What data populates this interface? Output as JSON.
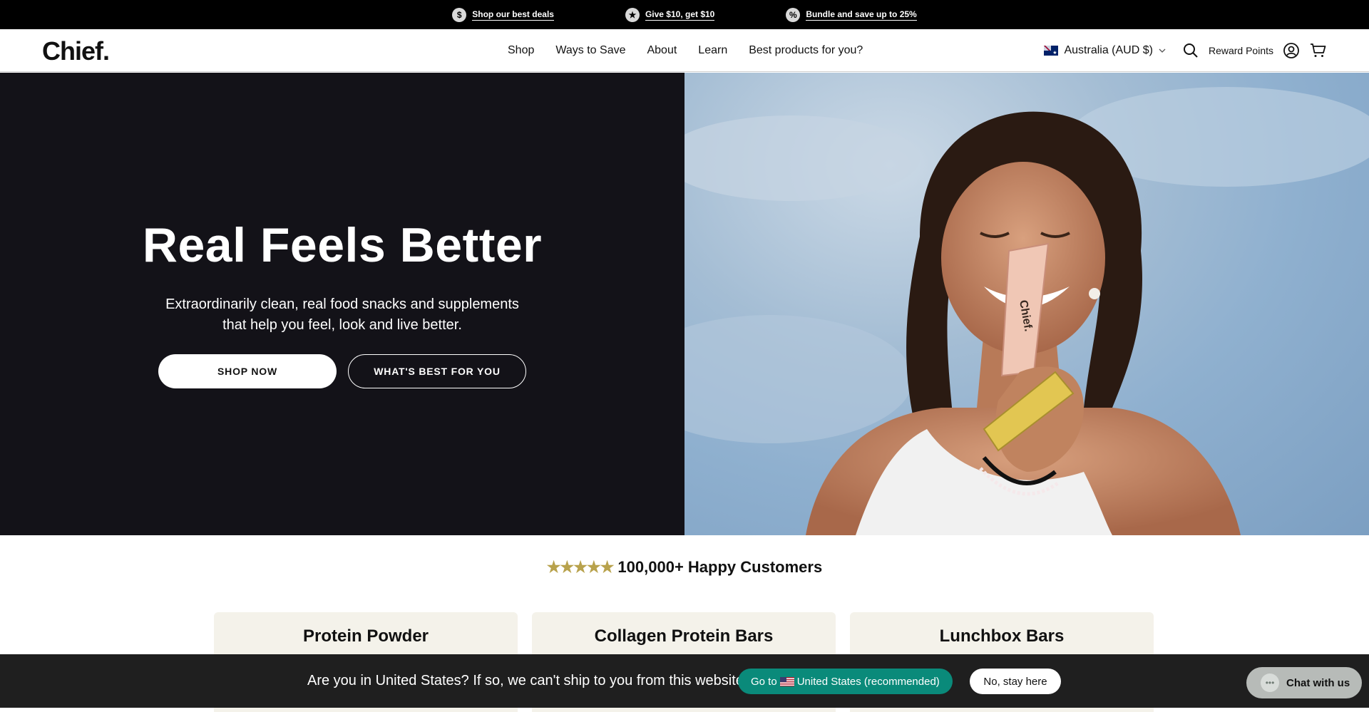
{
  "announcement": {
    "items": [
      {
        "icon": "dollar-icon",
        "label": "Shop our best deals"
      },
      {
        "icon": "star-icon",
        "label": "Give $10, get $10"
      },
      {
        "icon": "percent-icon",
        "label": "Bundle and save up to 25%"
      }
    ]
  },
  "header": {
    "logo": "Chief.",
    "nav": [
      "Shop",
      "Ways to Save",
      "About",
      "Learn",
      "Best products for you?"
    ],
    "country": "Australia (AUD $)",
    "reward_label": "Reward Points"
  },
  "hero": {
    "title": "Real Feels Better",
    "subtitle": "Extraordinarily clean, real food snacks and supplements that help you feel, look and live better.",
    "primary_button": "SHOP NOW",
    "secondary_button": "WHAT'S BEST FOR YOU"
  },
  "reviews": {
    "stars": "★★★★★",
    "text": "100,000+ Happy Customers"
  },
  "cards": [
    "Protein Powder",
    "Collagen Protein Bars",
    "Lunchbox Bars"
  ],
  "geo_banner": {
    "question": "Are you in United States? If so, we can't ship to you from this website.",
    "go_prefix": "Go to",
    "go_label": "United States (recommended)",
    "stay_label": "No, stay here"
  },
  "chat": {
    "label": "Chat with us"
  },
  "colors": {
    "hero_dark": "#131218",
    "accent_teal": "#0a8a7a",
    "star_gold": "#b8a24c",
    "card_bg": "#f4f2ea"
  }
}
